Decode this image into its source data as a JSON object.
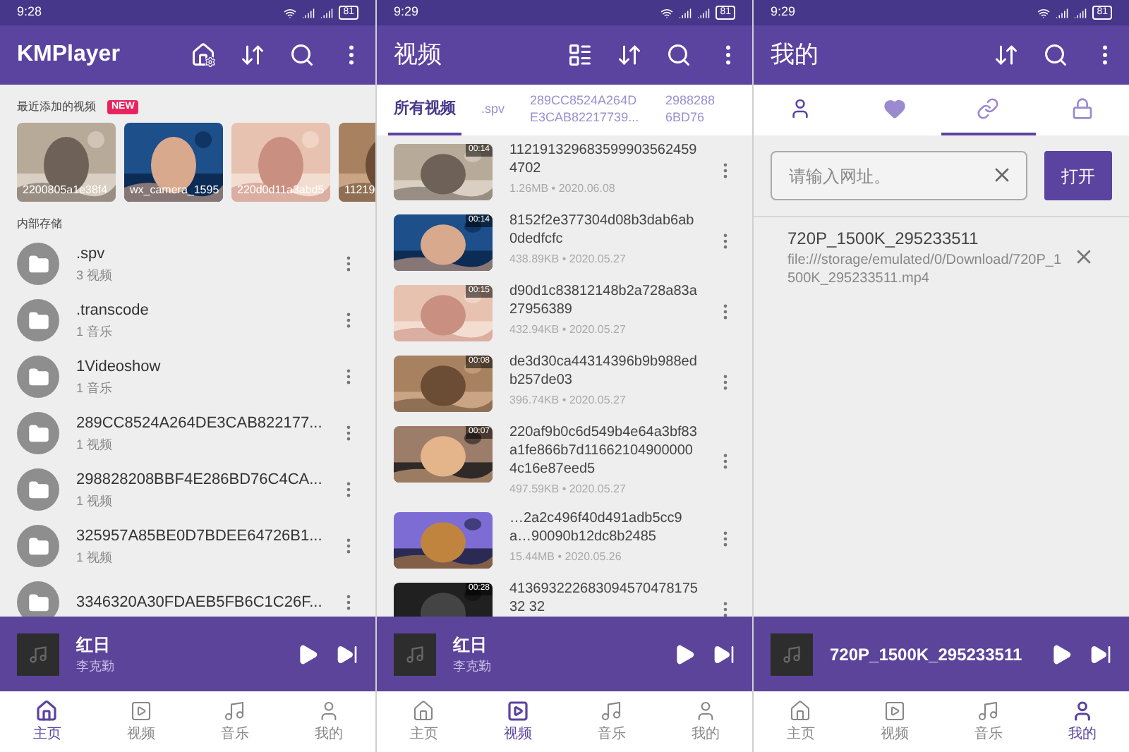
{
  "screens": [
    {
      "kind": "home",
      "status": {
        "time": "9:28",
        "battery": "81"
      },
      "header": {
        "title": "KMPlayer"
      },
      "recent": {
        "label": "最近添加的视频",
        "badge": "NEW",
        "items": [
          {
            "caption": "2200805a1e38f4"
          },
          {
            "caption": "wx_camera_1595"
          },
          {
            "caption": "220d0d11a3abd5"
          },
          {
            "caption": "11219"
          }
        ]
      },
      "storage": {
        "label": "内部存储",
        "folders": [
          {
            "name": ".spv",
            "count": "3 视频"
          },
          {
            "name": ".transcode",
            "count": "1 音乐"
          },
          {
            "name": "1Videoshow",
            "count": "1 音乐"
          },
          {
            "name": "289CC8524A264DE3CAB822177...",
            "count": "1 视频"
          },
          {
            "name": "298828208BBF4E286BD76C4CA...",
            "count": "1 视频"
          },
          {
            "name": "325957A85BE0D7BDEE64726B1...",
            "count": "1 视频"
          },
          {
            "name": "3346320A30FDAEB5FB6C1C26F..."
          }
        ]
      },
      "player": {
        "title": "红日",
        "artist": "李克勤"
      },
      "nav": [
        {
          "kind": "home",
          "label": "主页",
          "selected": true
        },
        {
          "kind": "video",
          "label": "视频",
          "selected": false
        },
        {
          "kind": "music",
          "label": "音乐",
          "selected": false
        },
        {
          "kind": "user",
          "label": "我的",
          "selected": false
        }
      ]
    },
    {
      "kind": "videos",
      "status": {
        "time": "9:29",
        "battery": "81"
      },
      "header": {
        "title": "视频"
      },
      "tabs": [
        {
          "label": "所有视频",
          "selected": true
        },
        {
          "label": ".spv",
          "selected": false
        },
        {
          "label": "289CC8524A264DE3CAB82217739...",
          "selected": false
        },
        {
          "label": "29882886BD76",
          "selected": false
        }
      ],
      "videos": [
        {
          "title": "1121913296835999035624594702",
          "meta": "1.26MB • 2020.06.08",
          "duration": "00:14"
        },
        {
          "title": "8152f2e377304d08b3dab6ab0dedfcfc",
          "meta": "438.89KB • 2020.05.27",
          "duration": "00:14"
        },
        {
          "title": "d90d1c83812148b2a728a83a27956389",
          "meta": "432.94KB • 2020.05.27",
          "duration": "00:15"
        },
        {
          "title": "de3d30ca44314396b9b988edb257de03",
          "meta": "396.74KB • 2020.05.27",
          "duration": "00:08"
        },
        {
          "title": "220af9b0c6d549b4e64a3bf83a1fe866b7d116621049000004c16e87eed5",
          "meta": "497.59KB • 2020.05.27",
          "duration": "00:07"
        },
        {
          "title": "…2a2c496f40d491adb5cc9a…90090b12dc8b2485",
          "meta": "15.44MB • 2020.05.26"
        },
        {
          "title": "41369322268309457047817532 32",
          "duration": "00:28"
        }
      ],
      "player": {
        "title": "红日",
        "artist": "李克勤"
      },
      "nav": [
        {
          "kind": "home",
          "label": "主页",
          "selected": false
        },
        {
          "kind": "video",
          "label": "视频",
          "selected": true
        },
        {
          "kind": "music",
          "label": "音乐",
          "selected": false
        },
        {
          "kind": "user",
          "label": "我的",
          "selected": false
        }
      ]
    },
    {
      "kind": "mine",
      "status": {
        "time": "9:29",
        "battery": "81"
      },
      "header": {
        "title": "我的"
      },
      "icon_tabs": [
        {
          "kind": "user",
          "selected": false
        },
        {
          "kind": "heart",
          "selected": false
        },
        {
          "kind": "link",
          "selected": true
        },
        {
          "kind": "lock",
          "selected": false
        }
      ],
      "url": {
        "placeholder": "请输入网址。",
        "button": "打开"
      },
      "history": [
        {
          "title": "720P_1500K_295233511",
          "path": "file:///storage/emulated/0/Download/720P_1500K_295233511.mp4"
        }
      ],
      "player": {
        "title": "720P_1500K_295233511"
      },
      "nav": [
        {
          "kind": "home",
          "label": "主页",
          "selected": false
        },
        {
          "kind": "video",
          "label": "视频",
          "selected": false
        },
        {
          "kind": "music",
          "label": "音乐",
          "selected": false
        },
        {
          "kind": "user",
          "label": "我的",
          "selected": true
        }
      ]
    }
  ]
}
